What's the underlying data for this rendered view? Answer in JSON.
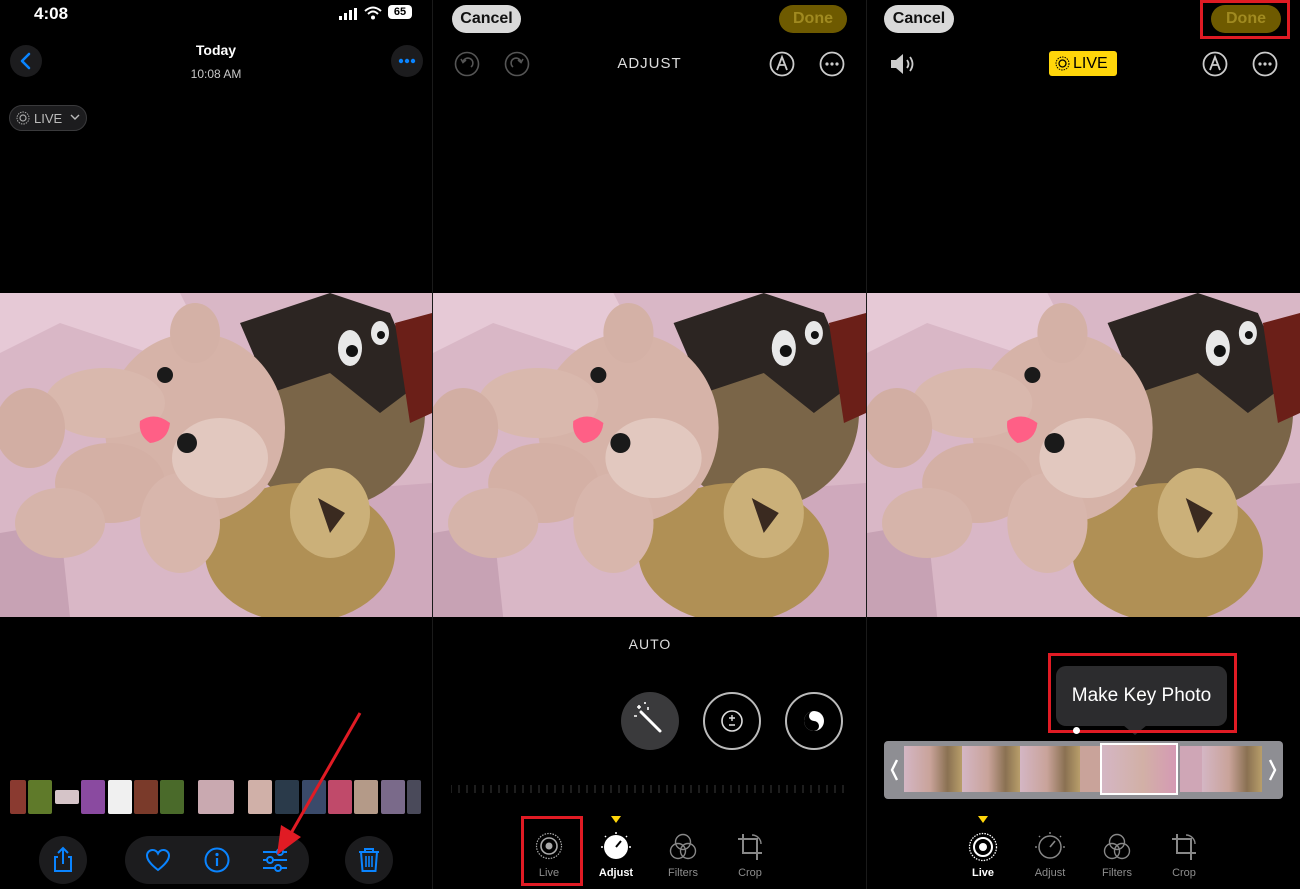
{
  "panel1": {
    "status_time": "4:08",
    "battery": "65",
    "header_title": "Today",
    "header_subtitle": "10:08 AM",
    "live_label": "LIVE"
  },
  "panel2": {
    "cancel_label": "Cancel",
    "done_label": "Done",
    "title": "ADJUST",
    "auto_label": "AUTO",
    "toolbar": {
      "live": "Live",
      "adjust": "Adjust",
      "filters": "Filters",
      "crop": "Crop"
    }
  },
  "panel3": {
    "cancel_label": "Cancel",
    "done_label": "Done",
    "live_badge": "LIVE",
    "tooltip": "Make Key Photo",
    "toolbar": {
      "live": "Live",
      "adjust": "Adjust",
      "filters": "Filters",
      "crop": "Crop"
    }
  },
  "colors": {
    "ios_blue": "#0a84ff",
    "live_yellow": "#ffd60a",
    "highlight_red": "#e01b24"
  },
  "icons": [
    "back-chevron-icon",
    "more-icon",
    "share-icon",
    "heart-icon",
    "info-icon",
    "sliders-icon",
    "trash-icon",
    "undo-icon",
    "redo-icon",
    "markup-icon",
    "speaker-icon",
    "magic-wand-icon",
    "exposure-icon",
    "brilliance-icon",
    "live-icon",
    "adjust-icon",
    "filters-icon",
    "crop-icon"
  ]
}
